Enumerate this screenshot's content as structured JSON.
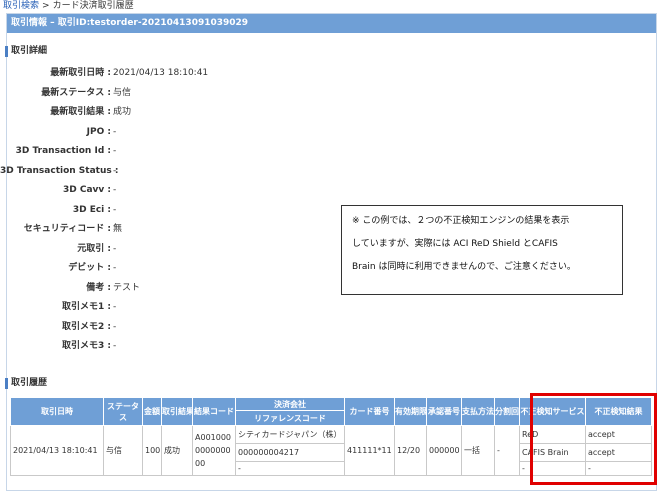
{
  "breadcrumb": {
    "link": "取引検索",
    "separator": ">",
    "current": "カード決済取引履歴"
  },
  "header": {
    "title": "取引情報 – 取引ID:testorder-20210413091039029"
  },
  "details": {
    "section_title": "取引詳細",
    "rows": [
      {
        "label": "最新取引日時 :",
        "value": "2021/04/13 18:10:41"
      },
      {
        "label": "最新ステータス :",
        "value": "与信"
      },
      {
        "label": "最新取引結果 :",
        "value": "成功"
      },
      {
        "label": "JPO :",
        "value": "-"
      },
      {
        "label": "3D Transaction Id :",
        "value": "-"
      },
      {
        "label": "3D Transaction Status :",
        "value": "-"
      },
      {
        "label": "3D Cavv :",
        "value": "-"
      },
      {
        "label": "3D Eci :",
        "value": "-"
      },
      {
        "label": "セキュリティコード :",
        "value": "無"
      },
      {
        "label": "元取引 :",
        "value": "-"
      },
      {
        "label": "デビット :",
        "value": "-"
      },
      {
        "label": "備考 :",
        "value": "テスト"
      },
      {
        "label": "取引メモ1 :",
        "value": "-"
      },
      {
        "label": "取引メモ2 :",
        "value": "-"
      },
      {
        "label": "取引メモ3 :",
        "value": "-"
      }
    ]
  },
  "note": {
    "line1": "※ この例では、２つの不正検知エンジンの結果を表示",
    "line2": "していますが、実際には ACI ReD Shield とCAFIS",
    "line3": "Brain は同時に利用できませんので、ご注意ください。"
  },
  "history": {
    "section_title": "取引履歴",
    "headers": {
      "date": "取引日時",
      "status": "ステータス",
      "amount": "金額",
      "result": "取引結果",
      "result_code": "結果コード",
      "company": "決済会社",
      "reference": "リファレンスコード",
      "card_number": "カード番号",
      "expiry": "有効期限",
      "approval": "承認番号",
      "payment_method": "支払方法",
      "installments": "分割回数",
      "fraud_service": "不正検知サービス",
      "fraud_result": "不正検知結果"
    },
    "row": {
      "date": "2021/04/13 18:10:41",
      "status": "与信",
      "amount": "100",
      "result": "成功",
      "result_code": "A001000000000000",
      "company": "シティカードジャパン（株）",
      "reference": "000000004217",
      "reference_sub": "-",
      "card_number": "411111*11",
      "expiry": "12/20",
      "approval": "000000",
      "payment_method": "一括",
      "installments": "-",
      "fraud": [
        {
          "service": "ReD",
          "result": "accept"
        },
        {
          "service": "CAFIS Brain",
          "result": "accept"
        },
        {
          "service": "-",
          "result": "-"
        }
      ]
    }
  },
  "colors": {
    "header_bg": "#6f9fd6",
    "link": "#2a62b8",
    "highlight": "#e00000"
  }
}
